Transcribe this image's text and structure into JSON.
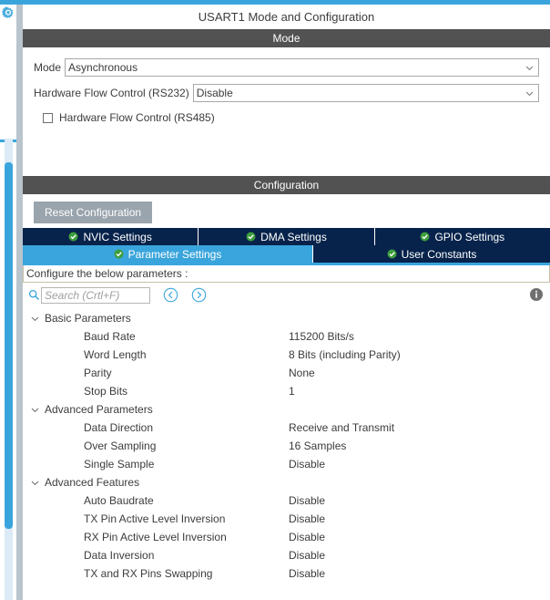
{
  "window": {
    "title": "USART1 Mode and Configuration",
    "gear_icon": "gear-icon"
  },
  "colors": {
    "accent_blue": "#3aa5dc",
    "tab_navy": "#07234b",
    "section_header_grey": "#525252",
    "button_grey": "#9aa4ad",
    "check_green": "#3d9e3d",
    "gutter_grey": "#b9c4cc",
    "scroll_track": "#dbeaf6"
  },
  "mode_section": {
    "header": "Mode",
    "mode_label": "Mode",
    "mode_value": "Asynchronous",
    "flow_control_label": "Hardware Flow Control (RS232)",
    "flow_control_value": "Disable",
    "rs485_label": "Hardware Flow Control (RS485)",
    "rs485_checked": false,
    "chevron_icon": "chevron-down-icon"
  },
  "configuration_section": {
    "header": "Configuration",
    "reset_button": "Reset Configuration",
    "tabs_row1": [
      {
        "label": "NVIC Settings",
        "selected": false,
        "icon": "check-circle-icon"
      },
      {
        "label": "DMA Settings",
        "selected": false,
        "icon": "check-circle-icon"
      },
      {
        "label": "GPIO Settings",
        "selected": false,
        "icon": "check-circle-icon"
      }
    ],
    "tabs_row2": [
      {
        "label": "Parameter Settings",
        "selected": true,
        "icon": "check-circle-icon"
      },
      {
        "label": "User Constants",
        "selected": false,
        "icon": "check-circle-icon"
      }
    ],
    "configure_banner": "Configure the below parameters :",
    "search": {
      "placeholder": "Search (Crtl+F)",
      "value": "",
      "icon": "search-icon",
      "prev_icon": "chevron-left-circle-icon",
      "next_icon": "chevron-right-circle-icon"
    },
    "info_icon": "info-icon"
  },
  "parameters": [
    {
      "group": "Basic Parameters",
      "expanded": true,
      "items": [
        {
          "name": "Baud Rate",
          "value": "115200 Bits/s"
        },
        {
          "name": "Word Length",
          "value": "8 Bits (including Parity)"
        },
        {
          "name": "Parity",
          "value": "None"
        },
        {
          "name": "Stop Bits",
          "value": "1"
        }
      ]
    },
    {
      "group": "Advanced Parameters",
      "expanded": true,
      "items": [
        {
          "name": "Data Direction",
          "value": "Receive and Transmit"
        },
        {
          "name": "Over Sampling",
          "value": "16 Samples"
        },
        {
          "name": "Single Sample",
          "value": "Disable"
        }
      ]
    },
    {
      "group": "Advanced Features",
      "expanded": true,
      "items": [
        {
          "name": "Auto Baudrate",
          "value": "Disable"
        },
        {
          "name": "TX Pin Active Level Inversion",
          "value": "Disable"
        },
        {
          "name": "RX Pin Active Level Inversion",
          "value": "Disable"
        },
        {
          "name": "Data Inversion",
          "value": "Disable"
        },
        {
          "name": "TX and RX Pins Swapping",
          "value": "Disable"
        }
      ]
    }
  ]
}
